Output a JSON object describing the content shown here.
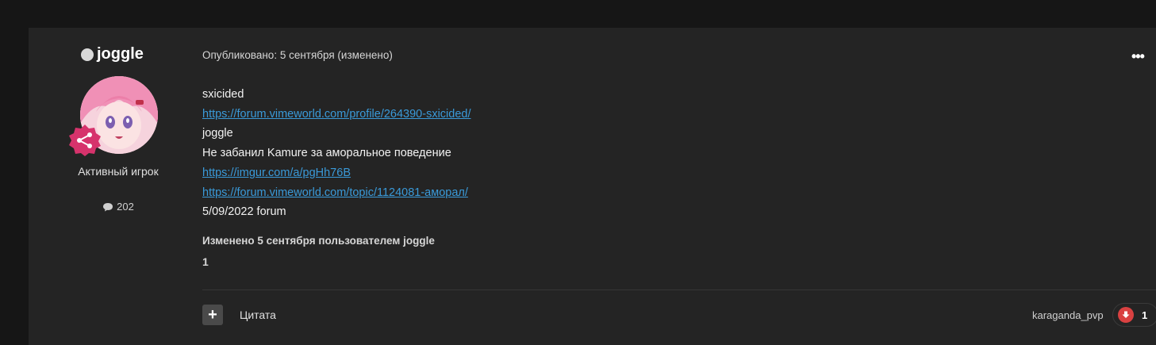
{
  "author": {
    "name": "joggle",
    "title": "Активный игрок",
    "post_count": "202"
  },
  "post": {
    "meta": "Опубликовано: 5 сентября (изменено)",
    "lines": [
      {
        "text": "sxicided",
        "link": false
      },
      {
        "text": "https://forum.vimeworld.com/profile/264390-sxicided/",
        "link": true
      },
      {
        "text": "joggle",
        "link": false
      },
      {
        "text": "Не забанил Kamure за аморальное поведение",
        "link": false
      },
      {
        "text": "https://imgur.com/a/pgHh76B",
        "link": true
      },
      {
        "text": "https://forum.vimeworld.com/topic/1124081-аморал/",
        "link": true
      },
      {
        "text": "5/09/2022 forum",
        "link": false
      }
    ],
    "edited": "Изменено 5 сентября пользователем joggle",
    "edit_reason": "1"
  },
  "actions": {
    "multiquote": "+",
    "quote": "Цитата",
    "more": "•••"
  },
  "reaction": {
    "user": "karaganda_pvp",
    "count": "1",
    "color": "#d94141"
  }
}
